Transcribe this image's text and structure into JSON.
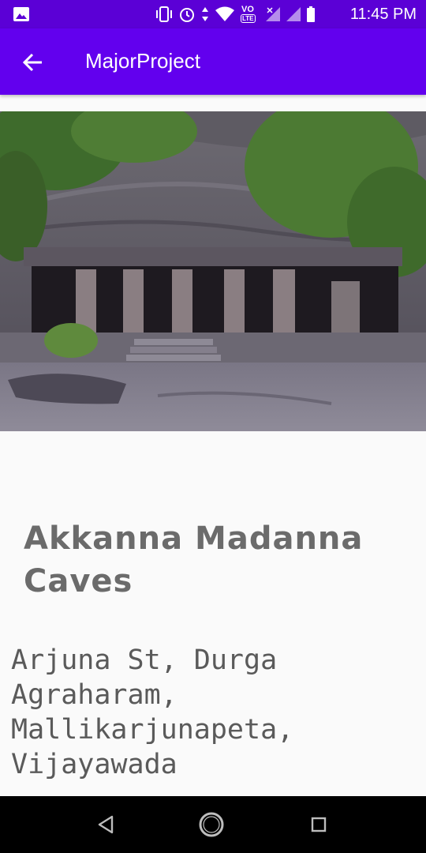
{
  "status_bar": {
    "time": "11:45 PM",
    "network_badge_top": "VO",
    "network_badge_bottom": "LTE",
    "icons": [
      "image-icon",
      "vibrate-icon",
      "alarm-icon",
      "data-arrows-icon",
      "wifi-icon",
      "volte-icon",
      "signal-icon",
      "signal-icon",
      "battery-icon"
    ]
  },
  "app_bar": {
    "title": "MajorProject",
    "back_icon": "arrow-back-icon",
    "color": "#6200ee"
  },
  "place": {
    "name": "Akkanna Madanna Caves",
    "address": "Arjuna St, Durga Agraharam, Mallikarjunapeta, Vijayawada"
  },
  "nav_bar": {
    "icons": [
      "back-triangle-icon",
      "home-circle-icon",
      "recents-square-icon"
    ]
  }
}
